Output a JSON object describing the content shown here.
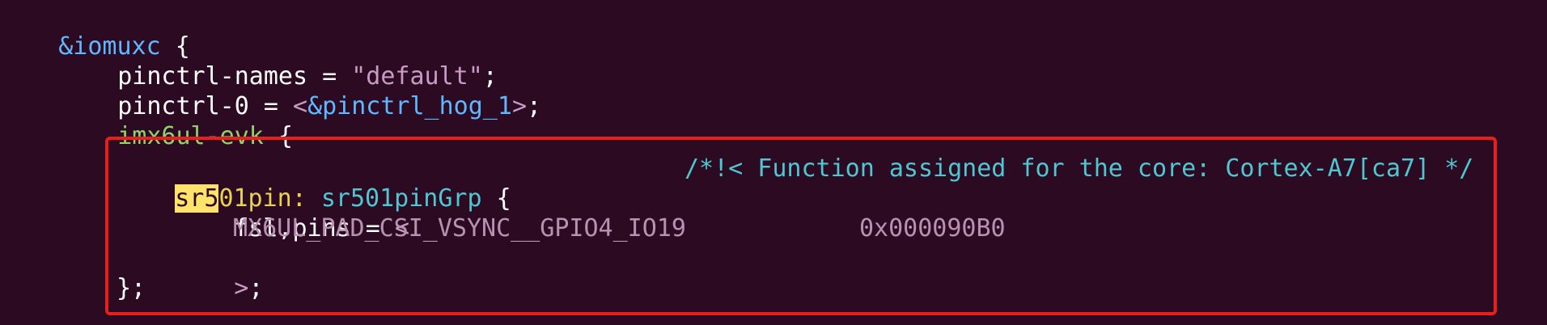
{
  "editor": {
    "line1": {
      "label": "&iomuxc",
      "brace": " {"
    },
    "line2": {
      "key": "pinctrl-names = ",
      "value": "\"default\"",
      "end": ";"
    },
    "line3": {
      "key": "pinctrl-0 = ",
      "open": "<",
      "ref": "&pinctrl_hog_1",
      "close": ">",
      "end": ";"
    },
    "line4": {
      "node": "imx6ul-evk",
      "brace": " {"
    },
    "line6": {
      "search_match": "sr5",
      "rest_label": "01pin:",
      "group": "sr501pinGrp",
      "brace": " {",
      "comment": "/*!< Function assigned for the core: Cortex-A7[ca7] */"
    },
    "line7": {
      "key": "fsl,pins = ",
      "open": "<"
    },
    "line8": {
      "macro": "MX6UL_PAD_CSI_VSYNC__GPIO4_IO19",
      "value": "0x000090B0"
    },
    "line9": {
      "close": ">",
      "end": ";"
    },
    "line10": {
      "end": "};"
    }
  },
  "colors": {
    "background": "#2c0a22",
    "highlight_border": "#e8201d",
    "search_match": "#ffe36b"
  }
}
